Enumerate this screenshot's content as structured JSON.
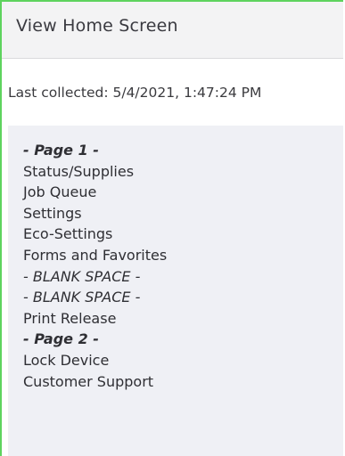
{
  "header": {
    "title": "View Home Screen"
  },
  "status": {
    "last_collected": "Last collected: 5/4/2021, 1:47:24 PM"
  },
  "home_screen": {
    "items": [
      {
        "label": "- Page 1 -",
        "kind": "page"
      },
      {
        "label": "Status/Supplies",
        "kind": "app"
      },
      {
        "label": "Job Queue",
        "kind": "app"
      },
      {
        "label": "Settings",
        "kind": "app"
      },
      {
        "label": "Eco-Settings",
        "kind": "app"
      },
      {
        "label": "Forms and Favorites",
        "kind": "app"
      },
      {
        "label": "- BLANK SPACE -",
        "kind": "blank"
      },
      {
        "label": "- BLANK SPACE -",
        "kind": "blank"
      },
      {
        "label": "Print Release",
        "kind": "app"
      },
      {
        "label": "- Page 2 -",
        "kind": "page"
      },
      {
        "label": "Lock Device",
        "kind": "app"
      },
      {
        "label": "Customer Support",
        "kind": "app"
      }
    ]
  },
  "colors": {
    "frame_border": "#5ed35e",
    "header_bg": "#f3f3f4",
    "panel_bg": "#eff0f5"
  }
}
